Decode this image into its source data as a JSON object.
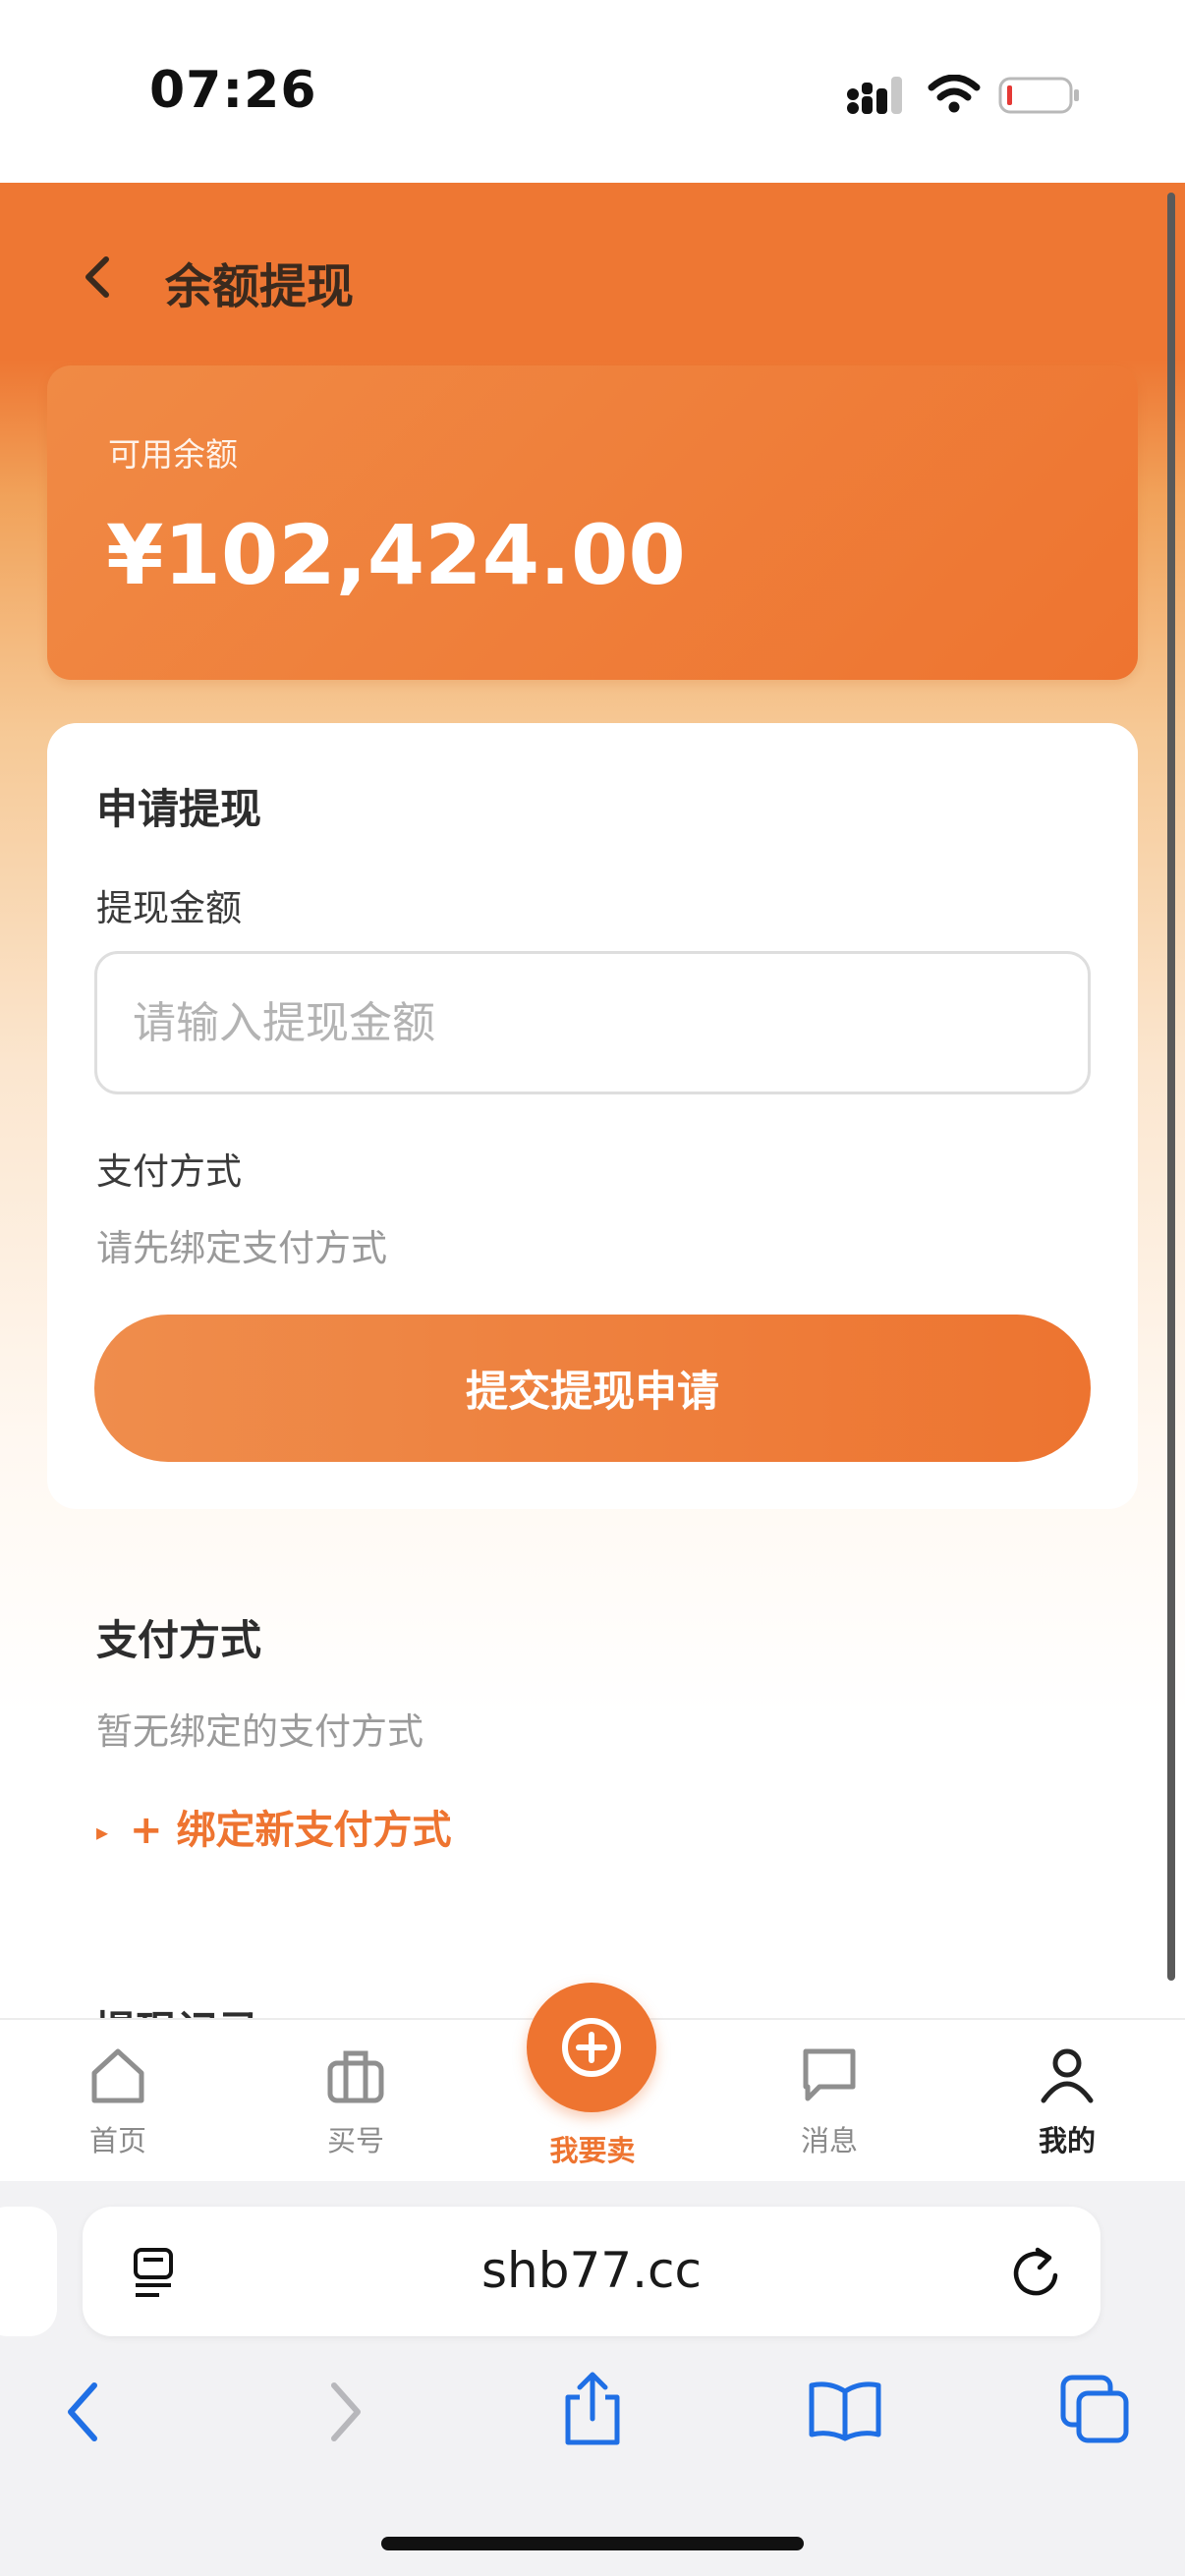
{
  "status_bar": {
    "time": "07:26"
  },
  "header": {
    "title": "余额提现"
  },
  "balance": {
    "label": "可用余额",
    "amount": "¥102,424.00"
  },
  "apply": {
    "title": "申请提现",
    "amount_label": "提现金额",
    "amount_placeholder": "请输入提现金额",
    "amount_value": "",
    "method_label": "支付方式",
    "method_hint": "请先绑定支付方式",
    "submit_label": "提交提现申请"
  },
  "payment_methods": {
    "title": "支付方式",
    "empty_text": "暂无绑定的支付方式",
    "bind_label": "+ 绑定新支付方式",
    "bind_marker": "▸"
  },
  "records": {
    "title": "提现记录"
  },
  "tab_bar": {
    "items": [
      {
        "label": "首页",
        "icon": "home-icon",
        "active": false
      },
      {
        "label": "买号",
        "icon": "briefcase-icon",
        "active": false
      },
      {
        "label": "我要卖",
        "icon": "plus-circle-icon",
        "active": false
      },
      {
        "label": "消息",
        "icon": "chat-icon",
        "active": false
      },
      {
        "label": "我的",
        "icon": "user-icon",
        "active": true
      }
    ]
  },
  "browser": {
    "url": "shb77.cc"
  },
  "colors": {
    "accent": "#ee7430",
    "header_bg": "#ee7733",
    "text_dark": "#2d2d2d",
    "muted": "#9a9a9a"
  }
}
